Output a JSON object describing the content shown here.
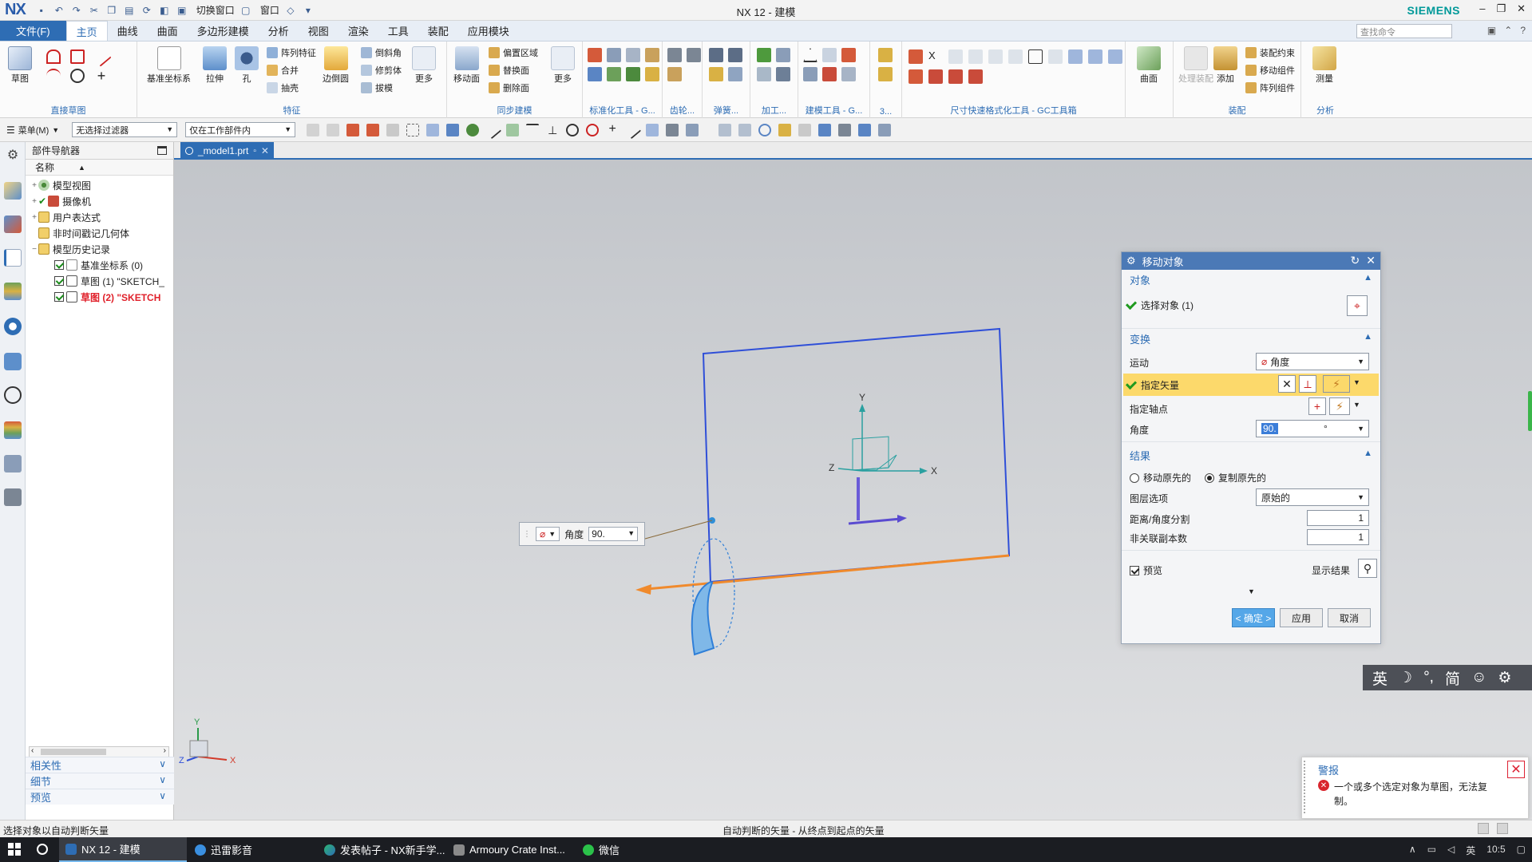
{
  "titlebar": {
    "app_logo": "NX",
    "quick_access": {
      "switch_window": "切换窗口",
      "window": "窗口"
    },
    "title": "NX 12 - 建模",
    "brand": "SIEMENS",
    "window_buttons": {
      "minimize": "–",
      "restore": "❐",
      "close": "✕"
    }
  },
  "menubar": {
    "file": "文件(F)",
    "tabs": [
      "主页",
      "曲线",
      "曲面",
      "多边形建模",
      "分析",
      "视图",
      "渲染",
      "工具",
      "装配",
      "应用模块"
    ],
    "active_tab": "主页",
    "search_placeholder": "查找命令"
  },
  "ribbon": {
    "groups": {
      "direct_sketch": {
        "label": "直接草图",
        "buttons": {
          "sketch": "草图"
        }
      },
      "feature": {
        "label": "特征",
        "buttons": {
          "datum_csys": "基准坐标系",
          "extrude": "拉伸",
          "hole": "孔",
          "pattern_feature": "阵列特征",
          "unite": "合并",
          "shell": "抽壳",
          "edge_blend": "边倒圆",
          "chamfer": "倒斜角",
          "trim_body": "修剪体",
          "draft": "拔模",
          "more": "更多"
        }
      },
      "sync_modeling": {
        "label": "同步建模",
        "buttons": {
          "move_face": "移动面",
          "offset_region": "偏置区域",
          "replace_face": "替换面",
          "delete_face": "删除面",
          "more": "更多"
        }
      },
      "standard_tools": {
        "label": "标准化工具 - G..."
      },
      "gear": {
        "label": "齿轮..."
      },
      "spring": {
        "label": "弹簧..."
      },
      "machining": {
        "label": "加工..."
      },
      "modeling_tools": {
        "label": "建模工具 - G..."
      },
      "misc": {
        "label": "3..."
      },
      "dim_tools": {
        "label": "尺寸快速格式化工具 - GC工具箱"
      },
      "surface": {
        "label": "",
        "buttons": {
          "surface": "曲面"
        }
      },
      "assembly": {
        "label": "装配",
        "buttons": {
          "process_assembly": "处理装配",
          "add": "添加",
          "assembly_constraint": "装配约束",
          "move_component": "移动组件",
          "pattern_component": "阵列组件"
        }
      },
      "analysis": {
        "label": "分析",
        "buttons": {
          "measure": "测量"
        }
      }
    }
  },
  "selbar": {
    "menu": "菜单(M)",
    "type_filter": "无选择过滤器",
    "scope": "仅在工作部件内"
  },
  "navigator": {
    "title": "部件导航器",
    "column": "名称",
    "items": [
      {
        "label": "模型视图",
        "toggle": "+",
        "checked": false,
        "style": "normal"
      },
      {
        "label": "摄像机",
        "toggle": "+",
        "checked": true,
        "style": "normal"
      },
      {
        "label": "用户表达式",
        "toggle": "+",
        "checked": false,
        "style": "normal"
      },
      {
        "label": "非时间戳记几何体",
        "toggle": "",
        "checked": false,
        "style": "normal"
      },
      {
        "label": "模型历史记录",
        "toggle": "−",
        "checked": false,
        "style": "normal"
      },
      {
        "label": "基准坐标系 (0)",
        "toggle": "",
        "checked": true,
        "style": "normal"
      },
      {
        "label": "草图 (1) \"SKETCH_",
        "toggle": "",
        "checked": true,
        "style": "normal"
      },
      {
        "label": "草图 (2) \"SKETCH",
        "toggle": "",
        "checked": true,
        "style": "red"
      }
    ],
    "sections": [
      "相关性",
      "细节",
      "预览"
    ]
  },
  "doc_tab": {
    "name": "_model1.prt"
  },
  "viewport": {
    "axis": {
      "x": "X",
      "y": "Y",
      "z": "Z"
    },
    "angle_input": {
      "label": "角度",
      "value": "90."
    }
  },
  "dialog": {
    "title": "移动对象",
    "object": {
      "header": "对象",
      "select_object": "选择对象 (1)"
    },
    "transform": {
      "header": "变换",
      "motion_label": "运动",
      "motion_value": "角度",
      "vector_label": "指定矢量",
      "pivot_label": "指定轴点",
      "angle_label": "角度",
      "angle_value": "90.",
      "angle_unit": "°"
    },
    "result": {
      "header": "结果",
      "move_original": "移动原先的",
      "copy_original": "复制原先的",
      "layer_label": "图层选项",
      "layer_value": "原始的",
      "distance_label": "距离/角度分割",
      "distance_value": "1",
      "copies_label": "非关联副本数",
      "copies_value": "1"
    },
    "preview_label": "预览",
    "show_result": "显示结果",
    "buttons": {
      "ok": "< 确定 >",
      "apply": "应用",
      "cancel": "取消"
    }
  },
  "ime": {
    "lang": "英",
    "moon": "☽",
    "punct": "°,",
    "simplified": "简",
    "emoji": "☺",
    "settings": "⚙"
  },
  "alert": {
    "title": "警报",
    "message": "一个或多个选定对象为草图，无法复制。",
    "close": "✕"
  },
  "statusbar": {
    "left": "选择对象以自动判断矢量",
    "center": "自动判断的矢量 - 从终点到起点的矢量"
  },
  "taskbar": {
    "apps": [
      {
        "label": "NX 12 - 建模",
        "active": true
      },
      {
        "label": "迅雷影音",
        "active": false
      },
      {
        "label": "发表帖子 - NX新手学...",
        "active": false
      },
      {
        "label": "Armoury Crate Inst...",
        "active": false
      },
      {
        "label": "微信",
        "active": false
      }
    ],
    "tray": {
      "ime": "英",
      "clock": "10:5"
    }
  },
  "colors": {
    "accent": "#2e6db4",
    "sketch_blue": "#2f4fd8",
    "vector_orange": "#f08a2c",
    "highlight": "#fcd96b",
    "error": "#d9262e"
  }
}
